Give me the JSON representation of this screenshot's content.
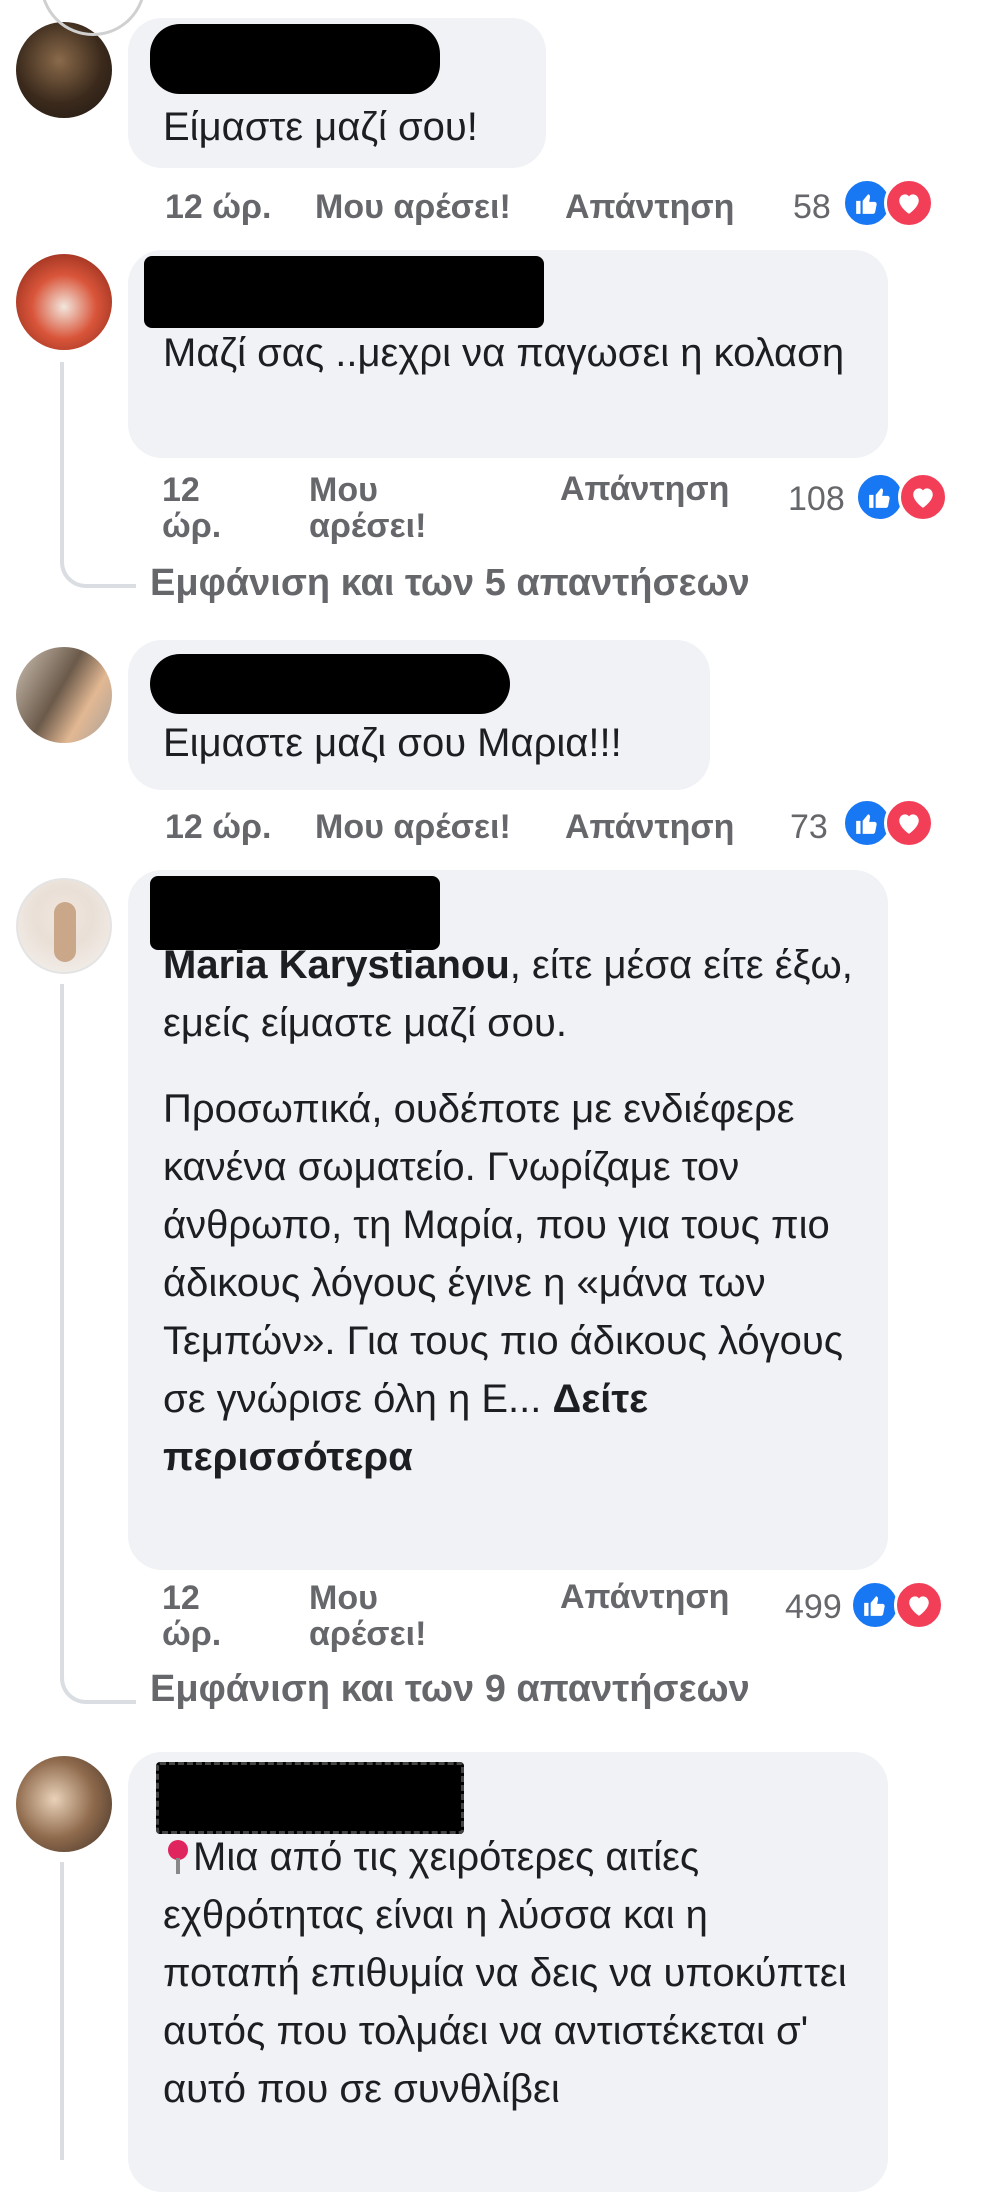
{
  "colors": {
    "bubble": "#f0f2f5",
    "meta_text": "#65676b",
    "like": "#1877f2",
    "love": "#f33e58"
  },
  "comments": [
    {
      "text": "Είμαστε μαζί σου!",
      "time": "12 ώρ.",
      "like_label": "Μου αρέσει!",
      "reply_label": "Απάντηση",
      "reaction_count": "58",
      "reactions": [
        "like-icon",
        "love-icon"
      ]
    },
    {
      "text": "Μαζί σας ..μεχρι να παγωσει η κολαση",
      "time_line1": "12",
      "time_line2": "ώρ.",
      "like_line1": "Μου",
      "like_line2": "αρέσει!",
      "reply_label": "Απάντηση",
      "reaction_count": "108",
      "reactions": [
        "like-icon",
        "love-icon"
      ],
      "view_replies": "Εμφάνιση και των 5 απαντήσεων"
    },
    {
      "text": "Ειμαστε μαζι σου Μαρια!!!",
      "time": "12 ώρ.",
      "like_label": "Μου αρέσει!",
      "reply_label": "Απάντηση",
      "reaction_count": "73",
      "reactions": [
        "like-icon",
        "love-icon"
      ]
    },
    {
      "mention": "Maria Karystianou",
      "text_after_mention": ", είτε μέσα είτε έξω, εμείς είμαστε μαζί σου.",
      "paragraph2": "Προσωπικά, ουδέποτε με ενδιέφερε κανένα σωματείο. Γνωρίζαμε τον άνθρωπο, τη Μαρία, που για τους πιο άδικους λόγους έγινε η «μάνα των Τεμπών». Για τους πιο άδικους λόγους σε γνώρισε όλη η Ε...",
      "see_more": "Δείτε περισσότερα",
      "time_line1": "12",
      "time_line2": "ώρ.",
      "like_line1": "Μου",
      "like_line2": "αρέσει!",
      "reply_label": "Απάντηση",
      "reaction_count": "499",
      "reactions": [
        "like-icon",
        "love-icon"
      ],
      "view_replies": "Εμφάνιση και των 9 απαντήσεων"
    },
    {
      "pin_icon": "round-pushpin-icon",
      "text": "Μια από τις χειρότερες αιτίες εχθρότητας είναι η λύσσα και η ποταπή επιθυμία να δεις να υποκύπτει αυτός που τολμάει να αντιστέκεται σ' αυτό που σε συνθλίβει"
    }
  ]
}
